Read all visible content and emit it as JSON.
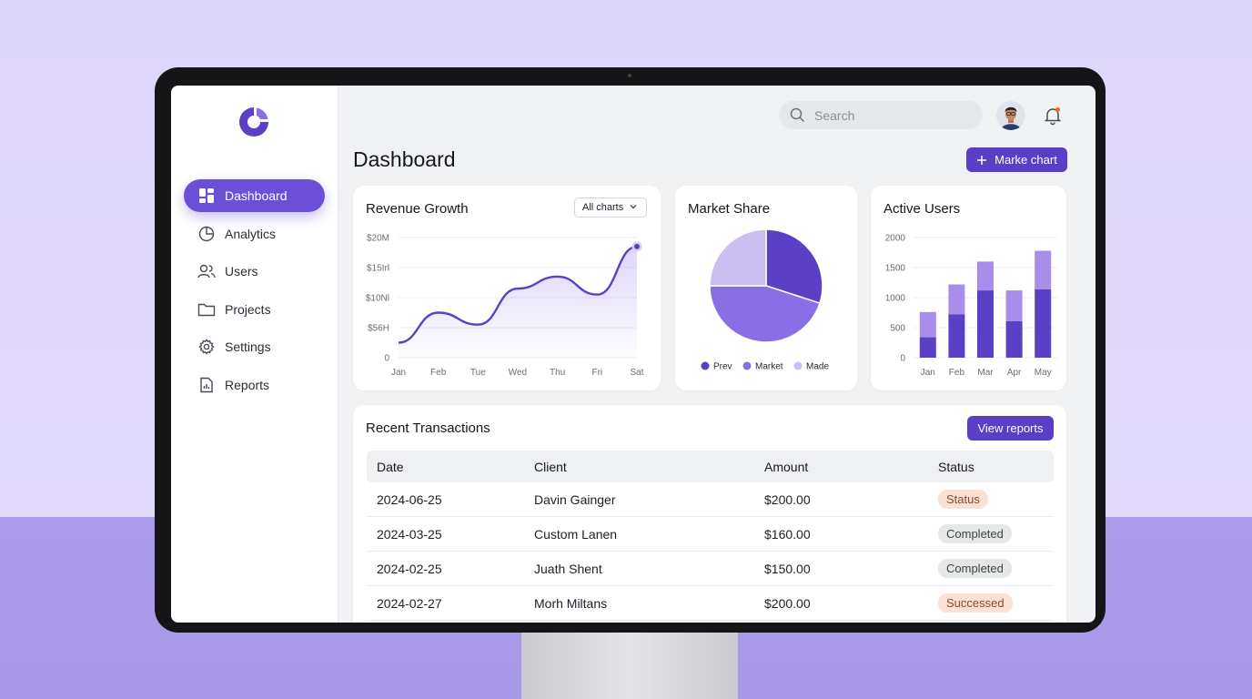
{
  "search": {
    "placeholder": "Search"
  },
  "sidebar": {
    "items": [
      {
        "label": "Dashboard",
        "icon": "dashboard-icon",
        "active": true
      },
      {
        "label": "Analytics",
        "icon": "analytics-icon"
      },
      {
        "label": "Users",
        "icon": "users-icon"
      },
      {
        "label": "Projects",
        "icon": "folder-icon"
      },
      {
        "label": "Settings",
        "icon": "gear-icon"
      },
      {
        "label": "Reports",
        "icon": "report-icon"
      }
    ]
  },
  "header": {
    "title": "Dashboard",
    "make_chart_label": "Marke chart"
  },
  "colors": {
    "accent": "#5a3fc6",
    "dark": "#5b3fc5",
    "mid": "#8a6ee6",
    "light": "#cbbff2"
  },
  "revenue": {
    "title": "Revenue Growth",
    "dropdown": "All charts",
    "chart_data": {
      "type": "area",
      "x": [
        "Jan",
        "Feb",
        "Tue",
        "Wed",
        "Thu",
        "Fri",
        "Sat"
      ],
      "y_ticks": [
        "$20M",
        "$15Irl",
        "$10Nl",
        "$56H",
        "0"
      ],
      "series": [
        {
          "values": [
            2.5,
            7.5,
            5.5,
            11.5,
            13.5,
            10.5,
            18.5
          ]
        }
      ],
      "ylim": [
        0,
        20
      ]
    }
  },
  "market": {
    "title": "Market Share",
    "chart_data": {
      "type": "pie",
      "labels": [
        "Prev",
        "Market",
        "Made"
      ],
      "values": [
        30,
        45,
        25
      ],
      "colors": [
        "#5b3fc5",
        "#8a6ee6",
        "#cbbff2"
      ]
    }
  },
  "active_users": {
    "title": "Active Users",
    "chart_data": {
      "type": "bar",
      "categories": [
        "Jan",
        "Feb",
        "Mar",
        "Apr",
        "May"
      ],
      "y_ticks": [
        "2000",
        "1500",
        "1000",
        "500",
        "0"
      ],
      "series": [
        {
          "values": [
            340,
            720,
            1120,
            610,
            1140
          ]
        },
        {
          "values": [
            420,
            500,
            480,
            510,
            640
          ]
        }
      ],
      "ylim": [
        0,
        2000
      ]
    }
  },
  "transactions": {
    "title": "Recent Transactions",
    "view_label": "View reports",
    "columns": [
      "Date",
      "Client",
      "Amount",
      "Status"
    ],
    "rows": [
      {
        "date": "2024-06-25",
        "client": "Davin Gainger",
        "amount": "$200.00",
        "status": "Status",
        "tone": "warn"
      },
      {
        "date": "2024-03-25",
        "client": "Custom Lanen",
        "amount": "$160.00",
        "status": "Completed",
        "tone": "ok"
      },
      {
        "date": "2024-02-25",
        "client": "Juath Shent",
        "amount": "$150.00",
        "status": "Completed",
        "tone": "ok"
      },
      {
        "date": "2024-02-27",
        "client": "Morh Miltans",
        "amount": "$200.00",
        "status": "Successed",
        "tone": "warn"
      }
    ]
  }
}
